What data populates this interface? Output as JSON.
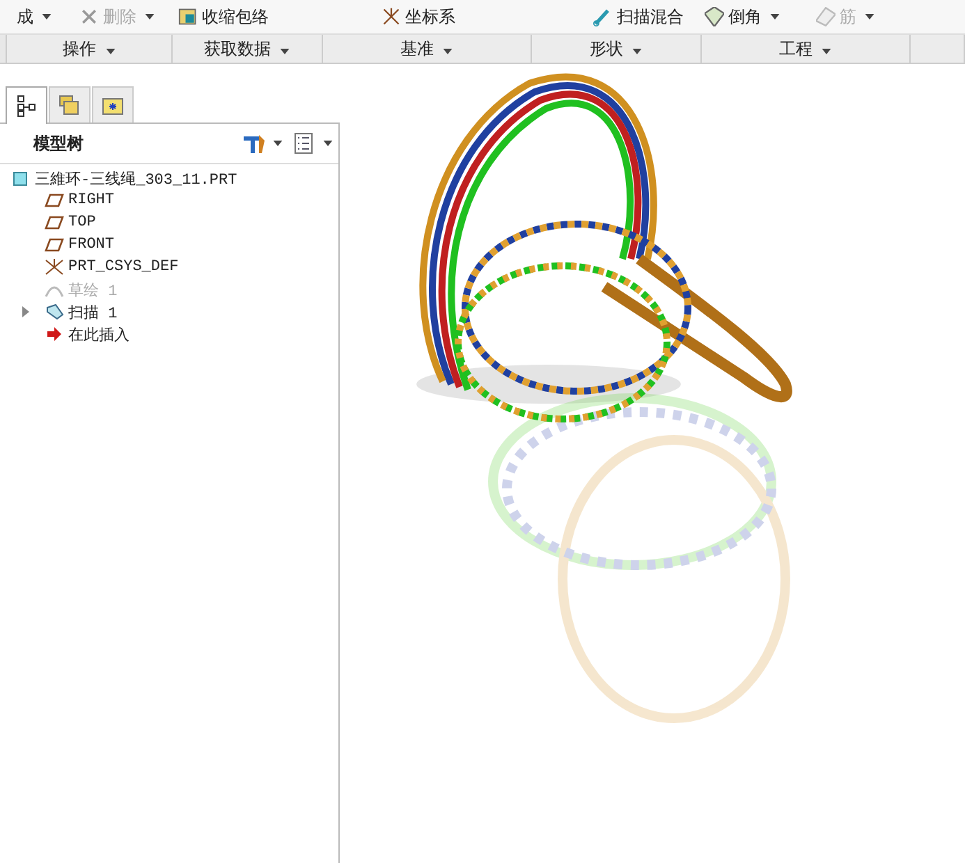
{
  "ribbon": {
    "commands": [
      {
        "kind": "dropdown",
        "label": "成",
        "disabled": false
      },
      {
        "kind": "dropdown",
        "label": "删除",
        "disabled": true
      },
      {
        "kind": "plain",
        "label": "收缩包络",
        "disabled": false
      },
      {
        "kind": "plain",
        "label": "坐标系",
        "disabled": false
      },
      {
        "kind": "plain",
        "label": "扫描混合",
        "disabled": false
      },
      {
        "kind": "dropdown",
        "label": "倒角",
        "disabled": false
      },
      {
        "kind": "dropdown",
        "label": "筋",
        "disabled": true
      }
    ],
    "groups": [
      {
        "label": "操作"
      },
      {
        "label": "获取数据"
      },
      {
        "label": "基准"
      },
      {
        "label": "形状"
      },
      {
        "label": "工程"
      }
    ]
  },
  "panel": {
    "tabs": [
      {
        "selected": true
      },
      {
        "selected": false
      },
      {
        "selected": false
      }
    ],
    "title": "模型树",
    "tree": [
      {
        "label": "三維环-三线绳_303_11.PRT",
        "kind": "part",
        "children": [
          {
            "label": "RIGHT",
            "kind": "plane",
            "disabled": false
          },
          {
            "label": "TOP",
            "kind": "plane",
            "disabled": false
          },
          {
            "label": "FRONT",
            "kind": "plane",
            "disabled": false
          },
          {
            "label": "PRT_CSYS_DEF",
            "kind": "csys",
            "disabled": false
          },
          {
            "label": "草绘 1",
            "kind": "sketch",
            "disabled": true
          },
          {
            "label": "扫描 1",
            "kind": "sweep",
            "disabled": false,
            "expanded": false
          },
          {
            "label": "在此插入",
            "kind": "insert",
            "disabled": false
          }
        ]
      }
    ]
  }
}
